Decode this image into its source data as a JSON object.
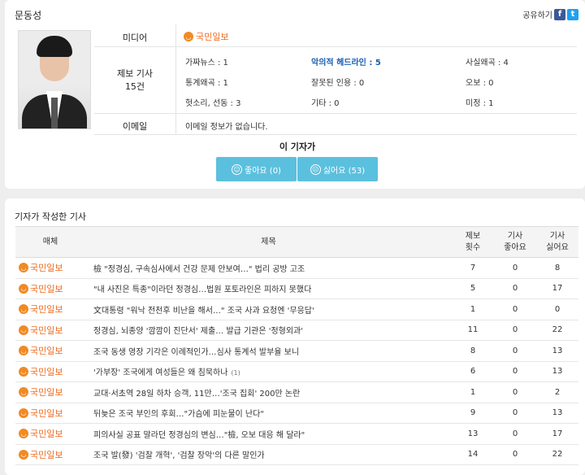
{
  "reporter": {
    "name": "문동성",
    "share_label": "공유하기",
    "share_icons": [
      "facebook-icon",
      "twitter-icon"
    ],
    "media_label": "미디어",
    "media_name": "국민일보",
    "report_label": "제보 기사",
    "report_count": "15건",
    "stats": [
      {
        "label": "가짜뉴스",
        "value": "1"
      },
      {
        "label": "악의적 헤드라인",
        "value": "5"
      },
      {
        "label": "사실왜곡",
        "value": "4"
      },
      {
        "label": "통계왜곡",
        "value": "1"
      },
      {
        "label": "잘못된 인용",
        "value": "0"
      },
      {
        "label": "오보",
        "value": "0"
      },
      {
        "label": "헛소리, 선동",
        "value": "3"
      },
      {
        "label": "기타",
        "value": "0"
      },
      {
        "label": "미정",
        "value": "1"
      }
    ],
    "email_label": "이메일",
    "email_value": "이메일 정보가 없습니다.",
    "vote_title": "이 기자가",
    "like_label": "좋아요 (0)",
    "dislike_label": "싫어요 (53)"
  },
  "articles": {
    "section_title": "기자가 작성한 기사",
    "columns": {
      "media": "매체",
      "title": "제목",
      "reports": "제보\n횟수",
      "likes": "기사\n좋아요",
      "dislikes": "기사\n싫어요"
    },
    "rows": [
      {
        "media": "국민일보",
        "title": "檢 \"정경심, 구속심사에서 건강 문제 안보여…\" 법리 공방 고조",
        "extra": "",
        "reports": "7",
        "likes": "0",
        "dislikes": "8"
      },
      {
        "media": "국민일보",
        "title": "\"내 사진은 특종\"이라던 정경심…법원 포토라인은 피하지 못했다",
        "extra": "",
        "reports": "5",
        "likes": "0",
        "dislikes": "17"
      },
      {
        "media": "국민일보",
        "title": "文대통령 \"워낙 전천후 비난을 해서…\" 조국 사과 요청엔 '무응답'",
        "extra": "",
        "reports": "1",
        "likes": "0",
        "dislikes": "0"
      },
      {
        "media": "국민일보",
        "title": "정경심, 뇌종양 '깜깜이 진단서' 제출… 발급 기관은 '정형외과'",
        "extra": "",
        "reports": "11",
        "likes": "0",
        "dislikes": "22"
      },
      {
        "media": "국민일보",
        "title": "조국 동생 영장 기각은 이례적인가…심사 통계석 발부율 보니",
        "extra": "",
        "reports": "8",
        "likes": "0",
        "dislikes": "13"
      },
      {
        "media": "국민일보",
        "title": "'가부장' 조국에게 여성들은 왜 침묵하나",
        "extra": "(1)",
        "reports": "6",
        "likes": "0",
        "dislikes": "13"
      },
      {
        "media": "국민일보",
        "title": "교대·서초역 28일 하차 승객, 11만…'조국 집회' 200만 논란",
        "extra": "",
        "reports": "1",
        "likes": "0",
        "dislikes": "2"
      },
      {
        "media": "국민일보",
        "title": "뒤늦은 조국 부인의 후회…\"가슴에 피눈물이 난다\"",
        "extra": "",
        "reports": "9",
        "likes": "0",
        "dislikes": "13"
      },
      {
        "media": "국민일보",
        "title": "피의사실 공표 말라던 정경심의 변심…\"檢, 오보 대응 해 달라\"",
        "extra": "",
        "reports": "13",
        "likes": "0",
        "dislikes": "17"
      },
      {
        "media": "국민일보",
        "title": "조국 발(發) '검찰 개혁', '검찰 장악'의 다른 말인가",
        "extra": "",
        "reports": "14",
        "likes": "0",
        "dislikes": "22"
      }
    ]
  }
}
